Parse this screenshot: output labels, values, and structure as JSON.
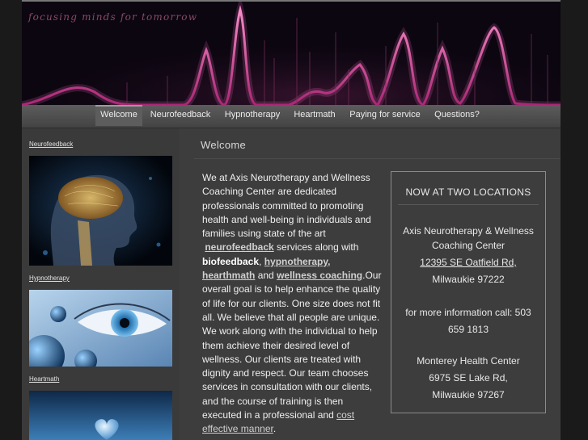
{
  "banner": {
    "tagline": "focusing minds for tomorrow"
  },
  "nav": {
    "items": [
      {
        "label": "Welcome",
        "active": true
      },
      {
        "label": "Neurofeedback"
      },
      {
        "label": "Hypnotherapy"
      },
      {
        "label": "Heartmath"
      },
      {
        "label": "Paying for service"
      },
      {
        "label": "Questions?"
      }
    ]
  },
  "sidebar": {
    "links": [
      "Neurofeedback",
      "Hypnotherapy",
      "Heartmath"
    ]
  },
  "main": {
    "heading": "Welcome",
    "intro": "We at Axis Neurotherapy and Wellness Coaching Center are dedicated professionals committed to promoting health and well-being in individuals and families using state of the art",
    "link_neurofeedback": "neurofeedback",
    "t_services": "services along with",
    "biofeedback": "biofeedback",
    "t_comma": ",",
    "link_hypnotherapy": "hypnotherapy,",
    "link_hearthmath": "hearthmath",
    "t_and": "and",
    "link_wellness": "wellness coaching",
    "body": ".Our overall goal is to help enhance the quality of life for our clients. One size does not fit all. We believe that all people are unique. We work along with the individual to help them achieve their desired level of wellness.  Our clients are treated with dignity and respect.  Our team chooses services in consultation with our clients, and the course of training is then executed in a professional and",
    "link_cost": "cost effective manner",
    "t_end": "."
  },
  "locations": {
    "title": "NOW AT TWO LOCATIONS",
    "loc1_name": "Axis Neurotherapy & Wellness Coaching Center",
    "loc1_street": "12395 SE Oatfield Rd,",
    "loc1_city": "Milwaukie 97222",
    "phone": "for more information call: 503 659 1813",
    "loc2_name": "Monterey Health Center",
    "loc2_street": "6975 SE Lake Rd,",
    "loc2_city": "Milwaukie 97267"
  },
  "colors": {
    "page_bg": "#1a1a1a",
    "content_bg": "#3d3d3d",
    "accent_pink": "#e05aa5",
    "link": "#d0d0d0"
  }
}
